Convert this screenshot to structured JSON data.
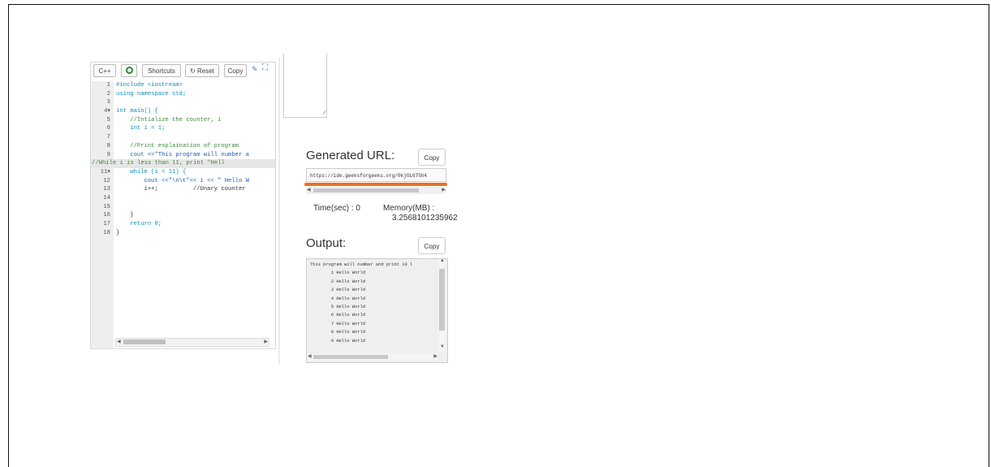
{
  "editor": {
    "toolbar": {
      "lang": "C++",
      "shortcuts": "Shortcuts",
      "reset": "↻ Reset",
      "copy": "Copy",
      "edit_icon": "pencil-icon",
      "expand_icon": "expand-icon",
      "run_icon": "run-icon"
    },
    "active_line": 10,
    "lines": [
      {
        "n": "1",
        "text": "#include <iostream>"
      },
      {
        "n": "2",
        "text": "using namespace std;"
      },
      {
        "n": "3",
        "text": ""
      },
      {
        "n": "4▾",
        "text": "int main() {"
      },
      {
        "n": "5",
        "text": "    //Intialize the counter, i"
      },
      {
        "n": "6",
        "text": "    int i = 1;"
      },
      {
        "n": "7",
        "text": ""
      },
      {
        "n": "8",
        "text": "    //Print explaination of program"
      },
      {
        "n": "9",
        "text": "    cout <<\"This program will number a"
      },
      {
        "n": "10",
        "text": "//While i is less than 11, print \"Hell"
      },
      {
        "n": "11▾",
        "text": "    while (i < 11) {"
      },
      {
        "n": "12",
        "text": "        cout <<\"\\n\\t\"<< i << \" Hello W"
      },
      {
        "n": "13",
        "text": "        i++;          //Unary counter"
      },
      {
        "n": "14",
        "text": ""
      },
      {
        "n": "15",
        "text": ""
      },
      {
        "n": "16",
        "text": "    }"
      },
      {
        "n": "17",
        "text": "    return 0;"
      },
      {
        "n": "18",
        "text": "}"
      }
    ]
  },
  "result": {
    "url_heading": "Generated URL:",
    "url_copy": "Copy",
    "url": "https://ide.geeksforgeeks.org/0kjOL67Sh4",
    "time_label": "Time(sec) : 0",
    "memory_label": "Memory(MB) :",
    "memory_value": "3.2568101235962",
    "output_heading": "Output:",
    "output_copy": "Copy",
    "output_lines": [
      "This program will number and print 10 l",
      "        1 Hello World",
      "        2 Hello World",
      "        3 Hello World",
      "        4 Hello World",
      "        5 Hello World",
      "        6 Hello World",
      "        7 Hello World",
      "        8 Hello World",
      "        9 Hello World"
    ]
  },
  "colors": {
    "accent_underline": "#e8711f",
    "keyword": "#0b8bbd",
    "comment": "#3a8a3a",
    "string": "#1a5fb4",
    "run_icon": "#2e8b2e"
  }
}
